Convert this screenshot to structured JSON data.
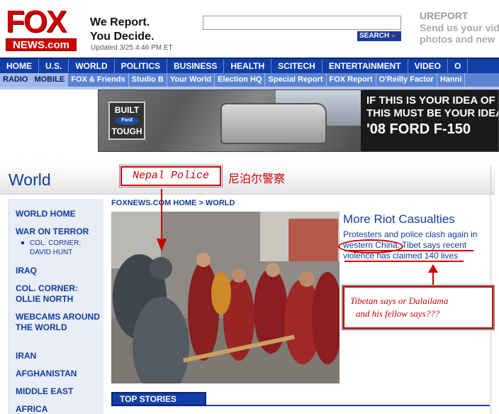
{
  "header": {
    "logo_top": "FOX",
    "logo_bottom": "NEWS.com",
    "slogan_line1": "We Report.",
    "slogan_line2": "You Decide.",
    "updated": "Updated 3/25 4:46 PM ET",
    "search_label": "SEARCH",
    "ureport_title": "UREPORT",
    "ureport_line1": "Send us your vid",
    "ureport_line2": "photos and new"
  },
  "nav_primary": [
    "HOME",
    "U.S.",
    "WORLD",
    "POLITICS",
    "BUSINESS",
    "HEALTH",
    "SCITECH",
    "ENTERTAINMENT",
    "VIDEO",
    "O"
  ],
  "nav_secondary": [
    "RADIO",
    "MOBILE",
    "FOX & Friends",
    "Studio B",
    "Your World",
    "Election HQ",
    "Special Report",
    "FOX Report",
    "O'Reilly Factor",
    "Hanni"
  ],
  "ad": {
    "badge_line1": "BUILT",
    "badge_brand": "Ford",
    "badge_line2": "TOUGH",
    "line1": "IF THIS IS YOUR IDEA OF A SP",
    "line2": "THIS MUST BE YOUR IDEA OF",
    "line3": "'08 FORD F-150"
  },
  "section": {
    "title": "World",
    "nepal_label": "Nepal Police",
    "nepal_cn": "尼泊尔警察"
  },
  "sidebar": {
    "world_home": "WORLD HOME",
    "war_on_terror": "WAR ON TERROR",
    "col_corner_hunt": "COL. CORNER: DAVID HUNT",
    "iraq": "IRAQ",
    "col_corner_north": "COL. CORNER: OLLIE NORTH",
    "webcams": "WEBCAMS AROUND THE WORLD",
    "iran": "IRAN",
    "afghanistan": "AFGHANISTAN",
    "middle_east": "MIDDLE EAST",
    "africa": "AFRICA"
  },
  "breadcrumb": "FOXNEWS.COM HOME > WORLD",
  "story": {
    "title": "More Riot Casualties",
    "text": "Protesters and police clash again in western China. Tibet says recent violence has claimed 140 lives"
  },
  "annotation": {
    "line1": "Tibetan says or Dalailama",
    "line2": "and his fellow says???"
  },
  "top_stories": "TOP STORIES",
  "colors": {
    "fox_red": "#cc0000",
    "nav_blue": "#123ea8",
    "link_blue": "#123c9a",
    "annotation_red": "#cc0000"
  }
}
